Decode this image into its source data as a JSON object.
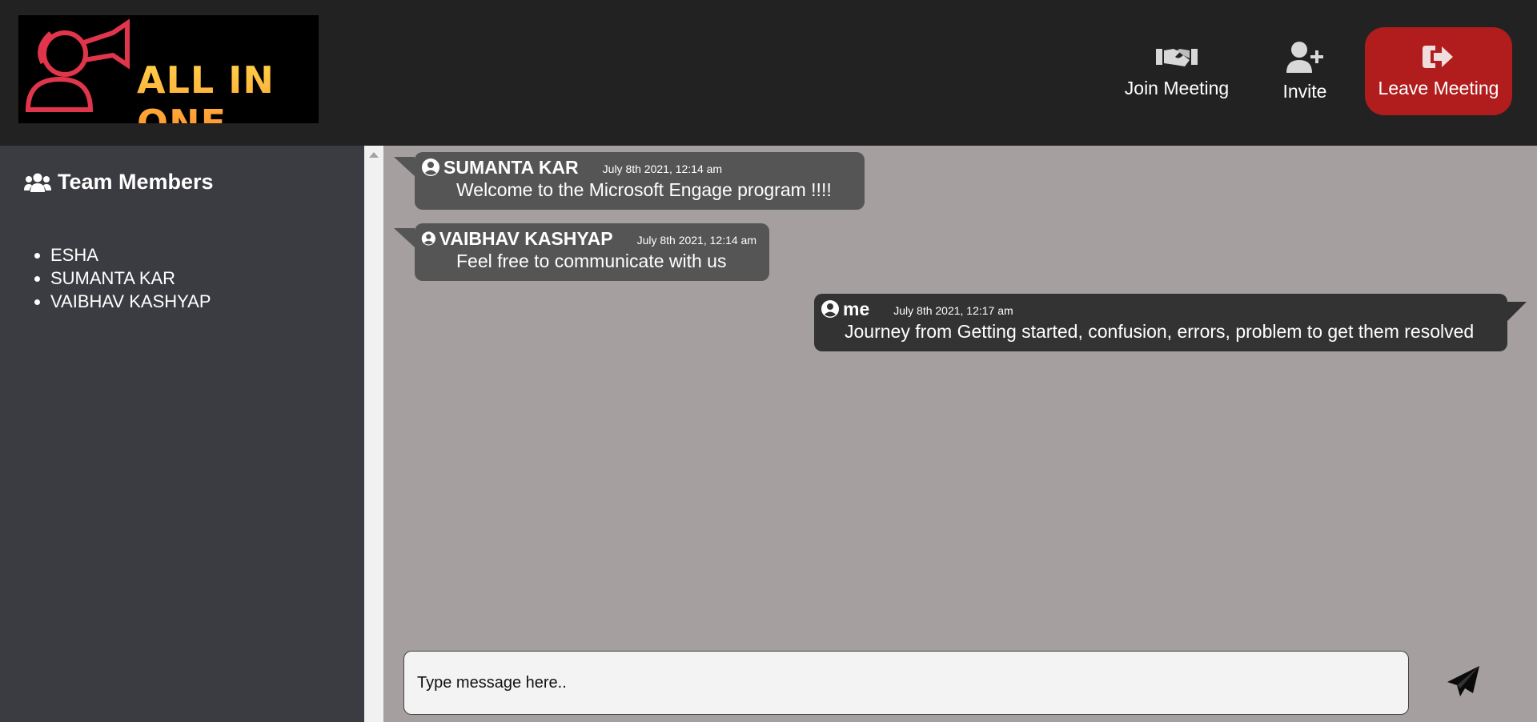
{
  "app": {
    "logo_text": "ALL IN ONE"
  },
  "header": {
    "join_label": "Join Meeting",
    "invite_label": "Invite",
    "leave_label": "Leave Meeting"
  },
  "sidebar": {
    "title": "Team Members",
    "members": [
      "ESHA",
      "SUMANTA KAR",
      "VAIBHAV KASHYAP"
    ]
  },
  "messages": [
    {
      "sender": "SUMANTA KAR",
      "time": "July 8th 2021, 12:14 am",
      "text": "Welcome to the Microsoft Engage program !!!!",
      "mine": false
    },
    {
      "sender": "VAIBHAV KASHYAP",
      "time": "July 8th 2021, 12:14 am",
      "text": "Feel free to communicate with us",
      "mine": false
    },
    {
      "sender": "me",
      "time": "July 8th 2021, 12:17 am",
      "text": "Journey from Getting started, confusion, errors, problem to get them resolved",
      "mine": true
    }
  ],
  "composer": {
    "placeholder": "Type message here..",
    "value": ""
  },
  "colors": {
    "header_bg": "#222222",
    "sidebar_bg": "#3b3b42",
    "chat_bg": "#a59f9f",
    "leave_bg": "#b11c1c",
    "bubble": "#555555",
    "bubble_mine": "#333333"
  },
  "icons": {
    "join": "handshake-icon",
    "invite": "user-plus-icon",
    "leave": "sign-out-icon",
    "team": "users-icon",
    "user": "user-circle-icon",
    "send": "paper-plane-icon"
  }
}
